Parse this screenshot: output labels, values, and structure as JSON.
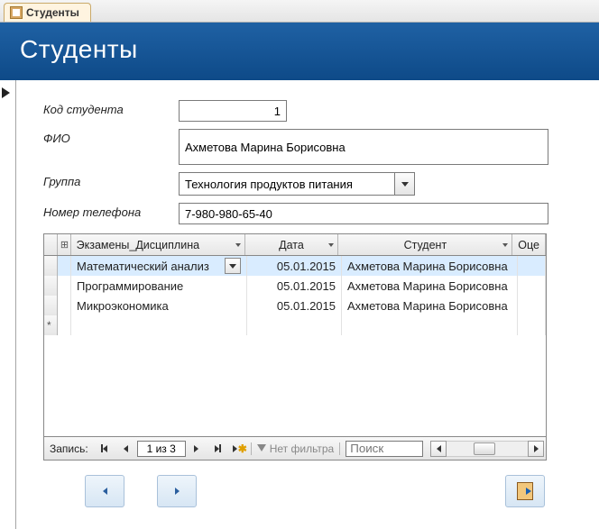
{
  "tab": {
    "title": "Студенты"
  },
  "header": {
    "title": "Студенты"
  },
  "fields": {
    "code_label": "Код студента",
    "code_value": "1",
    "fio_label": "ФИО",
    "fio_value": "Ахметова Марина Борисовна",
    "group_label": "Группа",
    "group_value": "Технология продуктов питания",
    "phone_label": "Номер телефона",
    "phone_value": "7-980-980-65-40"
  },
  "grid": {
    "columns": {
      "disc": "Экзамены_Дисциплина",
      "date": "Дата",
      "student": "Студент",
      "grade": "Оце"
    },
    "rows": [
      {
        "disc": "Математический анализ",
        "date": "05.01.2015",
        "student": "Ахметова Марина Борисовна",
        "selected": true
      },
      {
        "disc": "Программирование",
        "date": "05.01.2015",
        "student": "Ахметова Марина Борисовна",
        "selected": false
      },
      {
        "disc": "Микроэкономика",
        "date": "05.01.2015",
        "student": "Ахметова Марина Борисовна",
        "selected": false
      }
    ]
  },
  "nav": {
    "label": "Запись:",
    "position": "1 из 3",
    "filter_text": "Нет фильтра",
    "search_placeholder": "Поиск"
  }
}
